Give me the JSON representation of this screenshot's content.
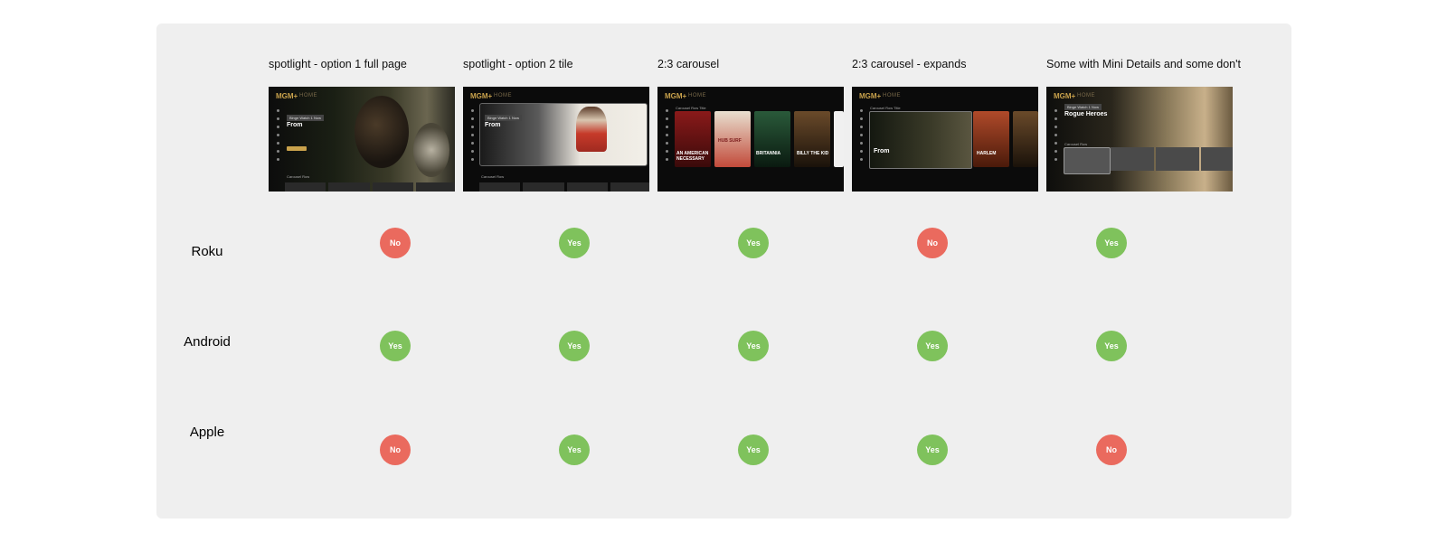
{
  "columns": [
    {
      "title": "spotlight - option 1 full page"
    },
    {
      "title": "spotlight - option 2 tile"
    },
    {
      "title": "2:3 carousel"
    },
    {
      "title": "2:3 carousel - expands"
    },
    {
      "title": "Some with Mini Details and some don't"
    }
  ],
  "thumb_text": {
    "logo": "MGM+",
    "home": "HOME",
    "from_title": "From",
    "rogue_title": "Rogue Heroes",
    "carousel_label": "Carousel Row",
    "carousel_title": "Carousel Row Title",
    "tag": "Binge Watch 1 Now",
    "posters": [
      "AN AMERICAN NECESSARY",
      "HUB SURF",
      "BRITANNIA",
      "BILLY THE KID"
    ],
    "expand_posters": [
      "HARLEM"
    ]
  },
  "rows": [
    {
      "label": "Roku",
      "values": [
        "No",
        "Yes",
        "Yes",
        "No",
        "Yes"
      ]
    },
    {
      "label": "Android",
      "values": [
        "Yes",
        "Yes",
        "Yes",
        "Yes",
        "Yes"
      ]
    },
    {
      "label": "Apple",
      "values": [
        "No",
        "Yes",
        "Yes",
        "Yes",
        "No"
      ]
    }
  ],
  "colors": {
    "yes": "#7fc25c",
    "no": "#ea6a5e",
    "panel": "#efefef"
  }
}
